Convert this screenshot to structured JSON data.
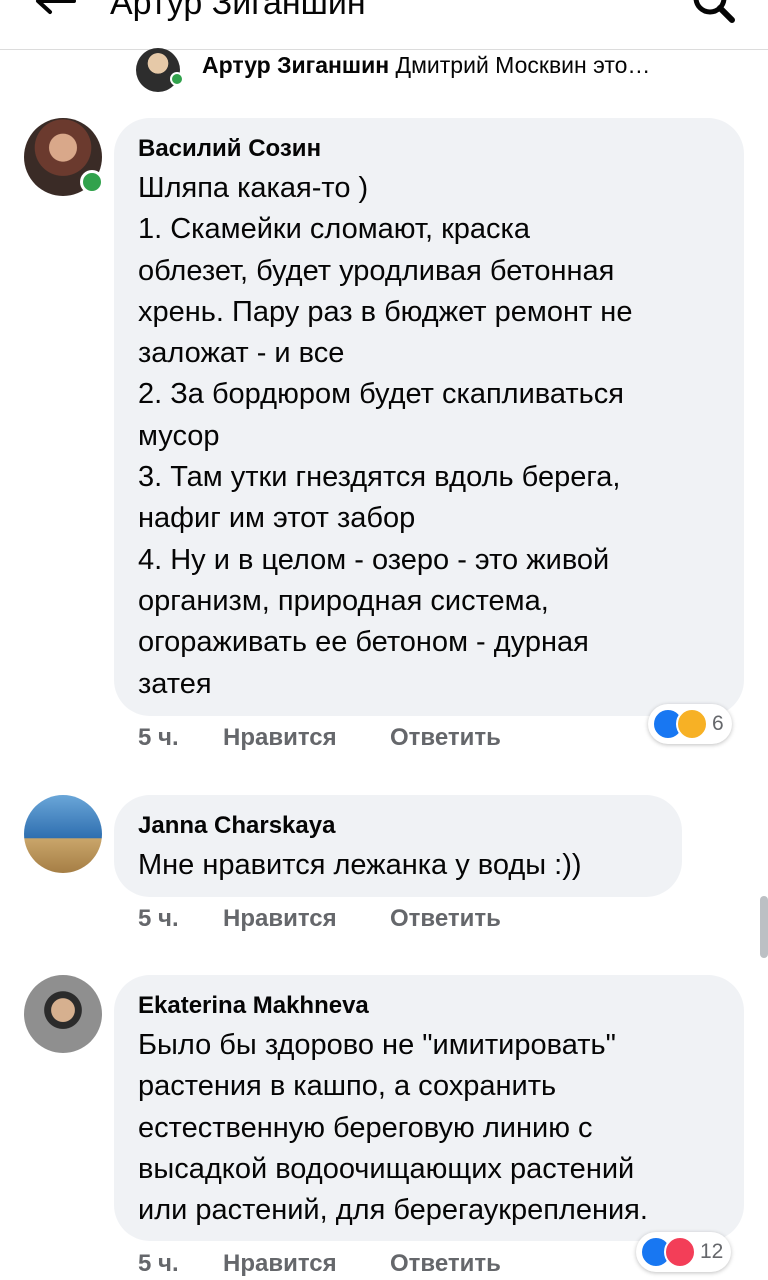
{
  "header": {
    "title": "Артур Зиганшин",
    "back_icon": "arrow-left-icon",
    "search_icon": "search-icon"
  },
  "reply_preview": {
    "author": "Артур Зиганшин",
    "snippet": "Дмитрий Москвин это…"
  },
  "comments": [
    {
      "author": "Василий Созин",
      "online": true,
      "text": "Шляпа какая-то )\n1. Скамейки сломают, краска\nоблезет, будет уродливая бетонная\nхрень. Пару раз в бюджет ремонт не\nзаложат - и все\n2. За бордюром будет скапливаться\nмусор\n3. Там утки гнездятся вдоль берега,\nнафиг им этот забор\n4. Ну и в целом - озеро - это живой\nорганизм, природная система,\nогораживать ее бетоном - дурная\nзатея",
      "time": "5 ч.",
      "like_label": "Нравится",
      "reply_label": "Ответить",
      "reactions": [
        "like",
        "care"
      ],
      "reaction_count": "6"
    },
    {
      "author": "Janna Charskaya",
      "online": false,
      "text": "Мне нравится лежанка у воды :))",
      "time": "5 ч.",
      "like_label": "Нравится",
      "reply_label": "Ответить"
    },
    {
      "author": "Ekaterina Makhneva",
      "online": false,
      "text": "Было бы здорово не \"имитировать\"\nрастения в кашпо, а сохранить\nестественную береговую линию с\nвысадкой водоочищающих растений\nили растений, для берегаукрепления.",
      "time": "5 ч.",
      "like_label": "Нравится",
      "reply_label": "Ответить",
      "reactions": [
        "like",
        "love"
      ],
      "reaction_count": "12"
    }
  ],
  "colors": {
    "bubble": "#f0f2f5",
    "meta_text": "#65676b",
    "online": "#31a24c",
    "like": "#1877f2",
    "love": "#f33e58",
    "care": "#f7b125"
  }
}
